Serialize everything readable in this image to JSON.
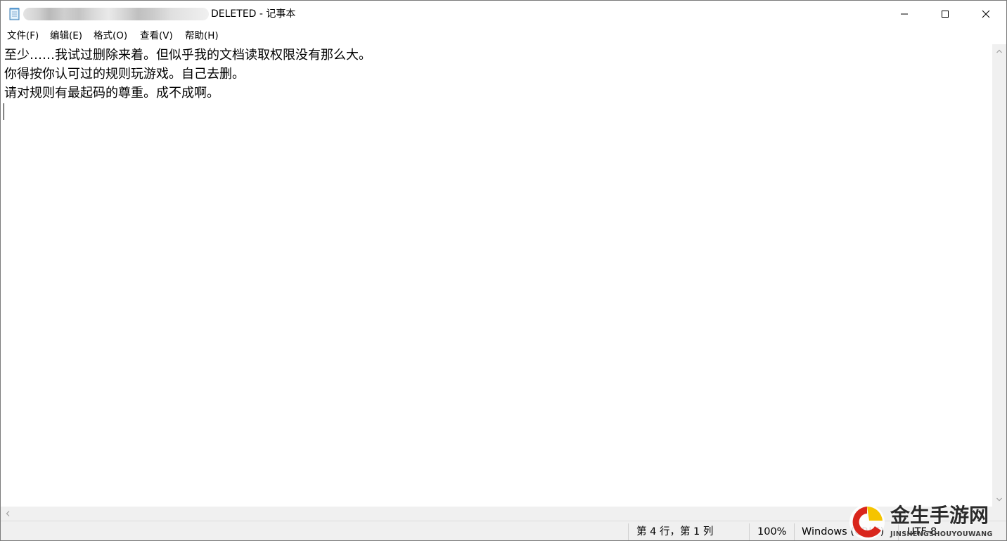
{
  "window": {
    "title": "DELETED - 记事本",
    "controls": {
      "minimize": "—",
      "maximize": "☐",
      "close": "✕"
    }
  },
  "menu": {
    "items": [
      "文件(F)",
      "编辑(E)",
      "格式(O)",
      "查看(V)",
      "帮助(H)"
    ]
  },
  "document": {
    "lines": [
      "至少……我试过删除来着。但似乎我的文档读取权限没有那么大。",
      "你得按你认可过的规则玩游戏。自己去删。",
      "请对规则有最起码的尊重。成不成啊。"
    ]
  },
  "status": {
    "position": "第 4 行，第 1 列",
    "zoom": "100%",
    "line_ending": "Windows (CRLF)",
    "encoding": "UTF-8"
  },
  "watermark": {
    "title": "金生手游网",
    "subtitle": "JINSHENGSHOUYOUWANG"
  },
  "icons": {
    "app": "notepad-icon",
    "scroll_up": "arrow-up-icon",
    "scroll_down": "arrow-down-icon",
    "scroll_left": "arrow-left-icon"
  },
  "colors": {
    "window_bg": "#ffffff",
    "chrome_bg": "#f0f0f0",
    "watermark_red": "#d9261c",
    "watermark_yellow": "#f5c400"
  }
}
